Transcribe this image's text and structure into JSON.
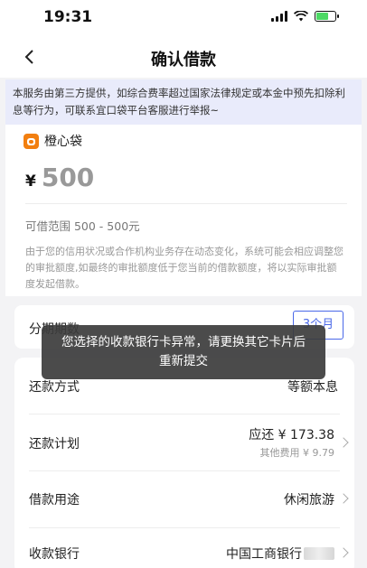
{
  "status_bar": {
    "time": "19:31"
  },
  "nav": {
    "title": "确认借款"
  },
  "notice": {
    "text": "本服务由第三方提供，如综合费率超过国家法律规定或本金中预先扣除利息等行为，可联系宜口袋平台客服进行举报~"
  },
  "brand": {
    "name": "橙心袋"
  },
  "loan": {
    "currency": "¥",
    "amount": "500",
    "range_text": "可借范围 500 - 500元",
    "hint": "由于您的信用状况或合作机构业务存在动态变化，系统可能会相应调整您的审批额度,如最终的审批额度低于您当前的借款额度，将以实际审批额度发起借款。"
  },
  "installment": {
    "label": "分期期数",
    "option": "3个月"
  },
  "rows": {
    "repay_method": {
      "label": "还款方式",
      "value": "等额本息"
    },
    "repay_plan": {
      "label": "还款计划",
      "value": "应还 ¥ 173.38",
      "sub": "其他费用 ¥ 9.79"
    },
    "purpose": {
      "label": "借款用途",
      "value": "休闲旅游"
    },
    "bank": {
      "label": "收款银行",
      "value": "中国工商银行"
    }
  },
  "toast": {
    "line1": "您选择的收款银行卡异常，请更换其它卡片后",
    "line2": "重新提交"
  },
  "colors": {
    "accent": "#4a68e8",
    "brand": "#f27f10",
    "notice_bg": "#e9ebfb"
  }
}
